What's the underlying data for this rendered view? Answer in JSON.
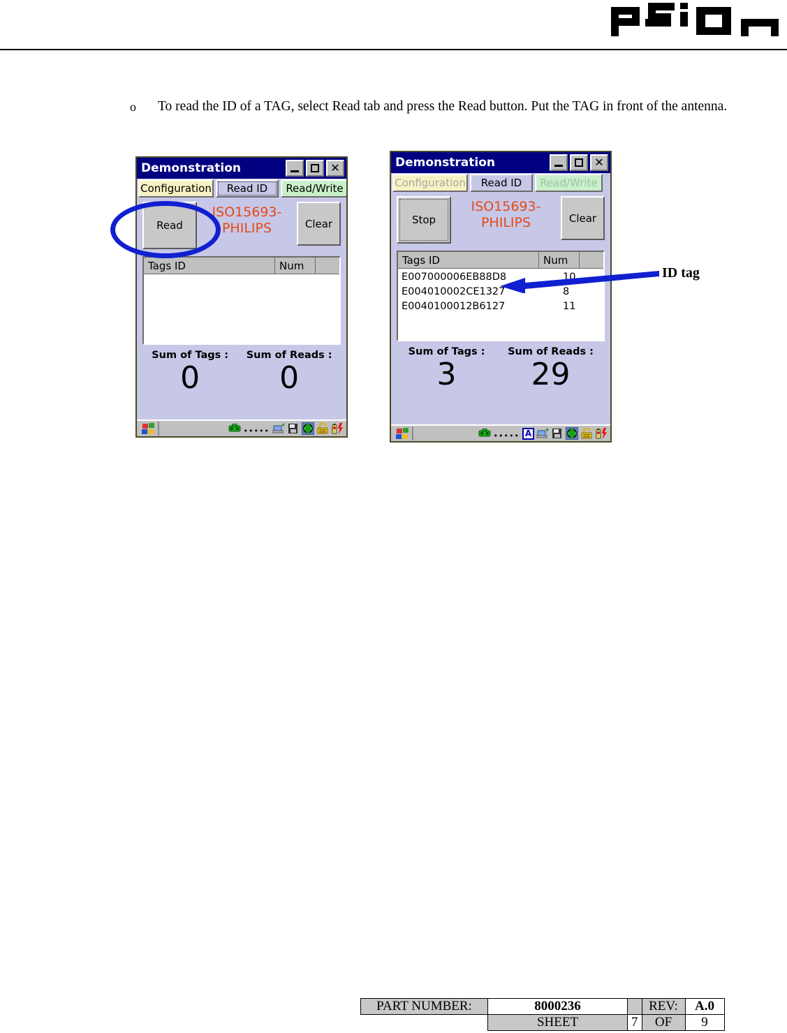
{
  "header": {
    "logo_text": "psion",
    "logo_icon": "psion-logo"
  },
  "body": {
    "bullet_marker": "o",
    "bullet_text": "To read the ID of a TAG, select Read tab and press the Read button. Put the TAG in front of the antenna."
  },
  "annotations": {
    "ellipse_target": "read-button",
    "arrow_target": "first-tag-row",
    "id_tag_label": "ID tag",
    "accent_color": "#1020d0"
  },
  "screenshot_left": {
    "window_title": "Demonstration",
    "titlebar_buttons": {
      "minimize": "_",
      "maximize": "□",
      "close": "×"
    },
    "tabs": [
      {
        "label": "Configuration",
        "state": "normal",
        "color": "#f7f2c4"
      },
      {
        "label": "Read ID",
        "state": "selected",
        "color": "#c7c7e8"
      },
      {
        "label": "Read/Write",
        "state": "normal",
        "color": "#c9f0ca"
      }
    ],
    "action_button": "Read",
    "protocol_line1": "ISO15693-",
    "protocol_line2": "PHILIPS",
    "protocol_color": "#e44a16",
    "clear_button": "Clear",
    "list_headers": {
      "tags": "Tags ID",
      "num": "Num",
      "pad": ""
    },
    "rows": [],
    "sum_of_tags_label": "Sum of Tags :",
    "sum_of_reads_label": "Sum of Reads :",
    "sum_of_tags_value": "0",
    "sum_of_reads_value": "0",
    "tray_icons": [
      "start-icon",
      "phone-icon",
      "signal-dots",
      "network-icon",
      "pc-icon",
      "globe-icon",
      "lock-icon",
      "battery-icon"
    ]
  },
  "screenshot_right": {
    "window_title": "Demonstration",
    "titlebar_buttons": {
      "minimize": "_",
      "maximize": "□",
      "close": "×"
    },
    "tabs": [
      {
        "label": "Configuration",
        "state": "disabled",
        "color": "#f7f2c4"
      },
      {
        "label": "Read ID",
        "state": "selected",
        "color": "#c7c7e8"
      },
      {
        "label": "Read/Write",
        "state": "disabled",
        "color": "#c9f0ca"
      }
    ],
    "action_button": "Stop",
    "protocol_line1": "ISO15693-",
    "protocol_line2": "PHILIPS",
    "protocol_color": "#e44a16",
    "clear_button": "Clear",
    "list_headers": {
      "tags": "Tags ID",
      "num": "Num",
      "pad": ""
    },
    "rows": [
      {
        "id": "E007000006EB88D8",
        "num": "10"
      },
      {
        "id": "E004010002CE1327",
        "num": "8"
      },
      {
        "id": "E0040100012B6127",
        "num": "11"
      }
    ],
    "sum_of_tags_label": "Sum of Tags :",
    "sum_of_reads_label": "Sum of Reads :",
    "sum_of_tags_value": "3",
    "sum_of_reads_value": "29",
    "tray_icons": [
      "start-icon",
      "phone-icon",
      "signal-dots",
      "input-a-icon",
      "network-icon",
      "pc-icon",
      "globe-icon",
      "lock-icon",
      "battery-icon"
    ]
  },
  "footer": {
    "part_number_label": "PART NUMBER:",
    "part_number_value": "8000236",
    "rev_label": "REV:",
    "rev_value": "A.0",
    "sheet_label": "SHEET",
    "sheet_value": "7",
    "of_label": "OF",
    "of_value": "9"
  }
}
